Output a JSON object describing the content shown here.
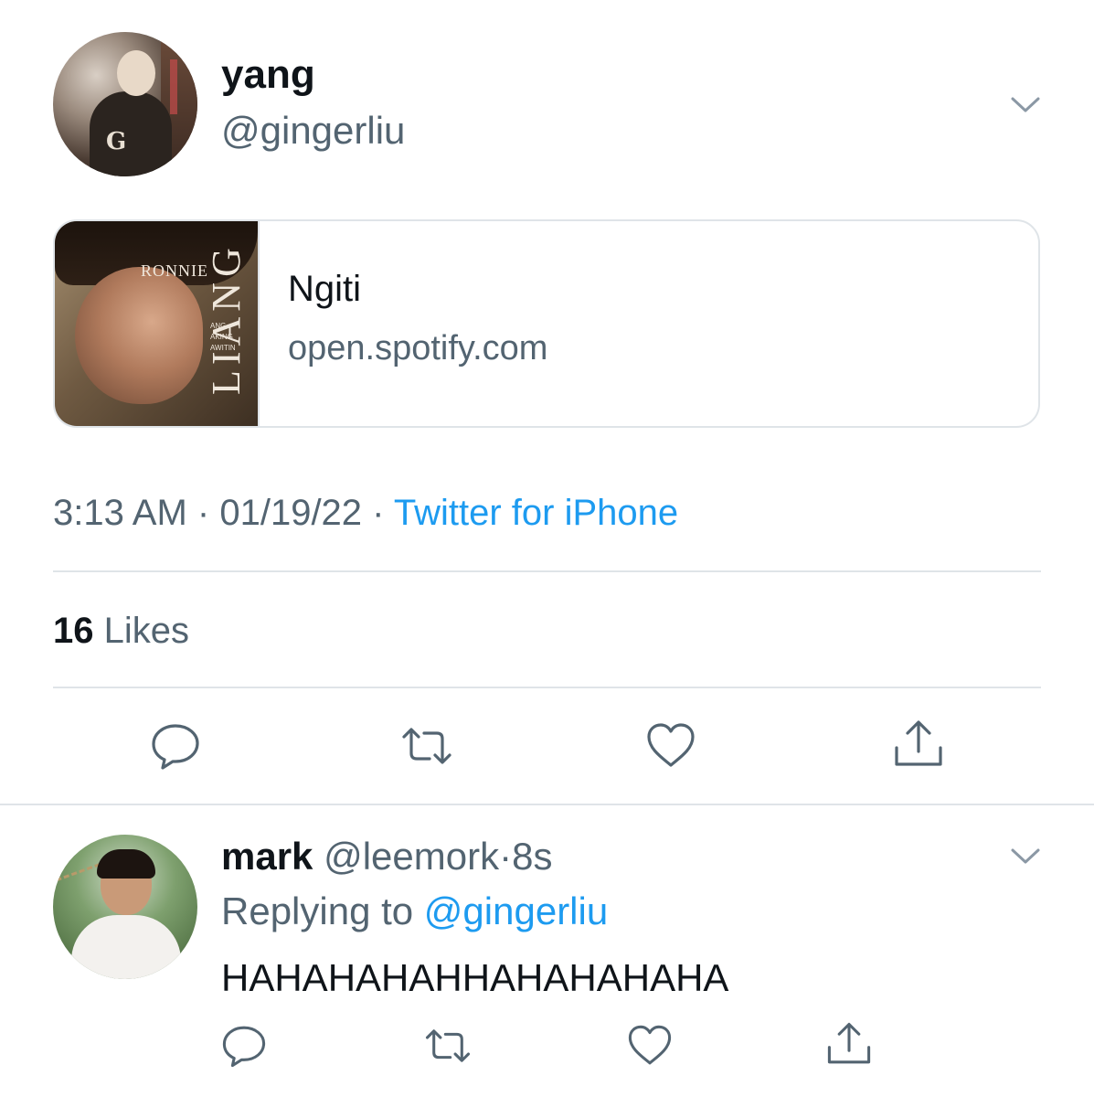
{
  "main_tweet": {
    "display_name": "yang",
    "handle": "@gingerliu",
    "card": {
      "title": "Ngiti",
      "domain": "open.spotify.com",
      "thumbnail_text": {
        "ronnie": "RONNIE",
        "liang": "LIANG",
        "line1": "ANG",
        "line2": "AKING",
        "line3": "AWITIN"
      }
    },
    "time": "3:13 AM",
    "date": "01/19/22",
    "separator": "·",
    "source": "Twitter for iPhone",
    "likes_count": "16",
    "likes_label": "Likes",
    "actions": [
      "reply-icon",
      "retweet-icon",
      "like-icon",
      "share-icon"
    ]
  },
  "reply_tweet": {
    "display_name": "mark",
    "handle": "@leemork",
    "separator": "·",
    "age": "8s",
    "replying_prefix": "Replying to",
    "replying_to": "@gingerliu",
    "text": "HAHAHAHAHHAHAHAHAHA",
    "actions": [
      "reply-icon",
      "retweet-icon",
      "like-icon",
      "share-icon"
    ]
  },
  "colors": {
    "text": "#0f1419",
    "secondary": "#536471",
    "link": "#1d9bf0",
    "divider": "#dfe4e8"
  }
}
